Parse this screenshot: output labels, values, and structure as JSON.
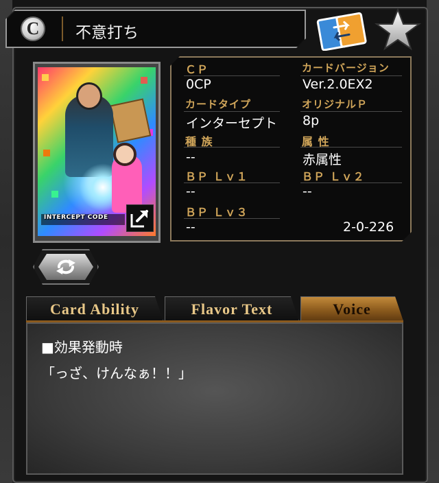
{
  "header": {
    "rarity": "C",
    "card_name": "不意打ち"
  },
  "icons": {
    "swap": "swap-cards-icon",
    "favorite": "star-icon",
    "expand": "expand-icon",
    "rotate": "rotate-icon"
  },
  "card_image": {
    "code_text": "INTERCEPT CODE"
  },
  "info": {
    "cp_label": "ＣＰ",
    "cp_value": "0CP",
    "version_label": "カードバージョン",
    "version_value": "Ver.2.0EX2",
    "type_label": "カードタイプ",
    "type_value": "インターセプト",
    "original_p_label": "オリジナルＰ",
    "original_p_value": "8p",
    "race_label": "種 族",
    "race_value": "--",
    "attribute_label": "属 性",
    "attribute_value": "赤属性",
    "bp1_label": "ＢＰ Ｌｖ１",
    "bp1_value": "--",
    "bp2_label": "ＢＰ Ｌｖ２",
    "bp2_value": "--",
    "bp3_label": "ＢＰ Ｌｖ３",
    "bp3_value": "--",
    "card_number": "2-0-226"
  },
  "tabs": [
    {
      "label": "Card Ability",
      "active": false
    },
    {
      "label": "Flavor Text",
      "active": false
    },
    {
      "label": "Voice",
      "active": true
    }
  ],
  "content": {
    "line1": "■効果発動時",
    "line2": "「っざ、けんなぁ！！」"
  },
  "colors": {
    "label_gold": "#d1a65a",
    "active_tab": "#c28a3a"
  }
}
